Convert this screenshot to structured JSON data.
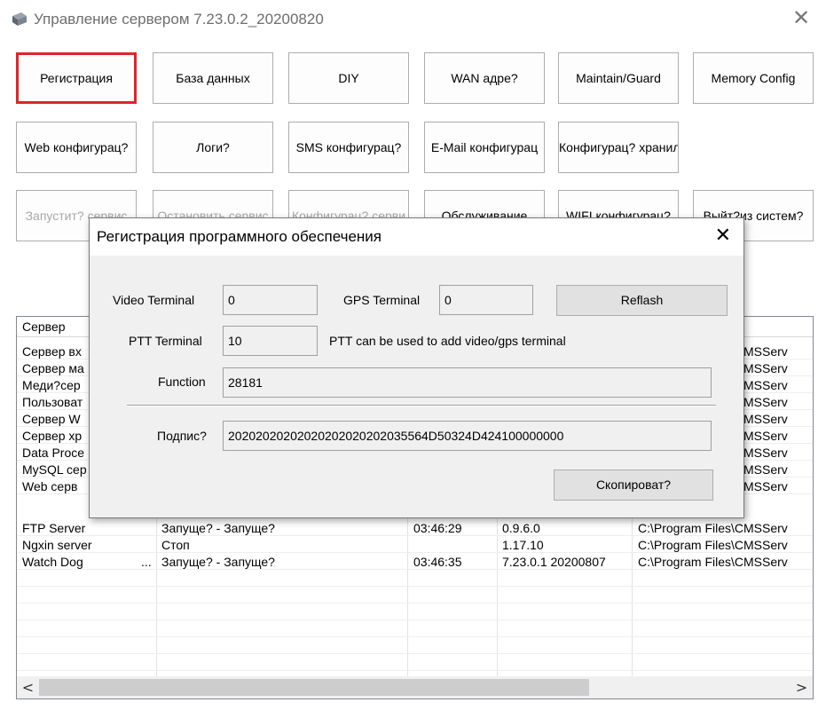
{
  "window": {
    "title": "Управление сервером 7.23.0.2_20200820",
    "icon": "server-app-icon",
    "close_glyph": "✕"
  },
  "toolbar": {
    "row1": [
      {
        "label": "Регистрация",
        "active": true
      },
      {
        "label": "База данных"
      },
      {
        "label": "DIY"
      },
      {
        "label": "WAN адре?"
      },
      {
        "label": "Maintain/Guard"
      },
      {
        "label": "Memory Config"
      }
    ],
    "row2": [
      {
        "label": "Web конфигурац?"
      },
      {
        "label": "Логи?"
      },
      {
        "label": "SMS конфигурац?"
      },
      {
        "label": "E-Mail конфигурац"
      },
      {
        "label": "Конфигурац? хранили"
      }
    ],
    "row3": [
      {
        "label": "Запустит? сервис",
        "disabled": true
      },
      {
        "label": "Остановить сервис",
        "disabled": true
      },
      {
        "label": "Конфигурац? серви",
        "disabled": true
      },
      {
        "label": "Обслуживание"
      },
      {
        "label": "WIFI конфигурац?"
      },
      {
        "label": "Выйт?из систем?"
      }
    ]
  },
  "table": {
    "header": {
      "server": "Сервер"
    },
    "rows": [
      {
        "name": "Сервер вх",
        "status": "",
        "time": "",
        "version": "",
        "path": "C:\\Program Files\\CMSServ"
      },
      {
        "name": "Сервер ма",
        "status": "",
        "time": "",
        "version": "",
        "path": "C:\\Program Files\\CMSServ"
      },
      {
        "name": "Меди?сер",
        "status": "",
        "time": "",
        "version": "",
        "path": "C:\\Program Files\\CMSServ"
      },
      {
        "name": "Пользоват",
        "status": "",
        "time": "",
        "version": "",
        "path": "C:\\Program Files\\CMSServ"
      },
      {
        "name": "Сервер W",
        "status": "",
        "time": "",
        "version": "",
        "path": "C:\\Program Files\\CMSServ"
      },
      {
        "name": "Сервер хр",
        "status": "",
        "time": "",
        "version": "",
        "path": "C:\\Program Files\\CMSServ"
      },
      {
        "name": "Data Proce",
        "status": "",
        "time": "",
        "version": "",
        "path": "C:\\Program Files\\CMSServ"
      },
      {
        "name": "MySQL сер",
        "status": "",
        "time": "",
        "version": "",
        "path": "C:\\Program Files\\CMSServ"
      },
      {
        "name": "Web серв",
        "status": "",
        "time": "",
        "version": "",
        "path": "C:\\Program Files\\CMSServ"
      },
      {
        "name": "FTP Server",
        "status": "Запуще? - Запуще?",
        "time": "03:46:29",
        "version": "0.9.6.0",
        "path": "C:\\Program Files\\CMSServ"
      },
      {
        "name": "Ngxin server",
        "status": "Стоп",
        "time": "",
        "version": "1.17.10",
        "path": "C:\\Program Files\\CMSServ"
      },
      {
        "name": "Watch Dog",
        "ellipsis": "...",
        "status": "Запуще? - Запуще?",
        "time": "03:46:35",
        "version": "7.23.0.1 20200807",
        "path": "C:\\Program Files\\CMSServ"
      }
    ],
    "scroll_left": "<",
    "scroll_right": ">"
  },
  "dialog": {
    "title": "Регистрация программного обеспечения",
    "close_glyph": "✕",
    "video_terminal_label": "Video Terminal",
    "video_terminal_value": "0",
    "gps_terminal_label": "GPS Terminal",
    "gps_terminal_value": "0",
    "reflash_label": "Reflash",
    "ptt_terminal_label": "PTT Terminal",
    "ptt_terminal_value": "10",
    "ptt_note": "PTT can be used to add video/gps terminal",
    "function_label": "Function",
    "function_value": "28181",
    "signature_label": "Подпис?",
    "signature_value": "20202020202020202020202035564D50324D424100000000",
    "copy_label": "Скопироват?"
  }
}
